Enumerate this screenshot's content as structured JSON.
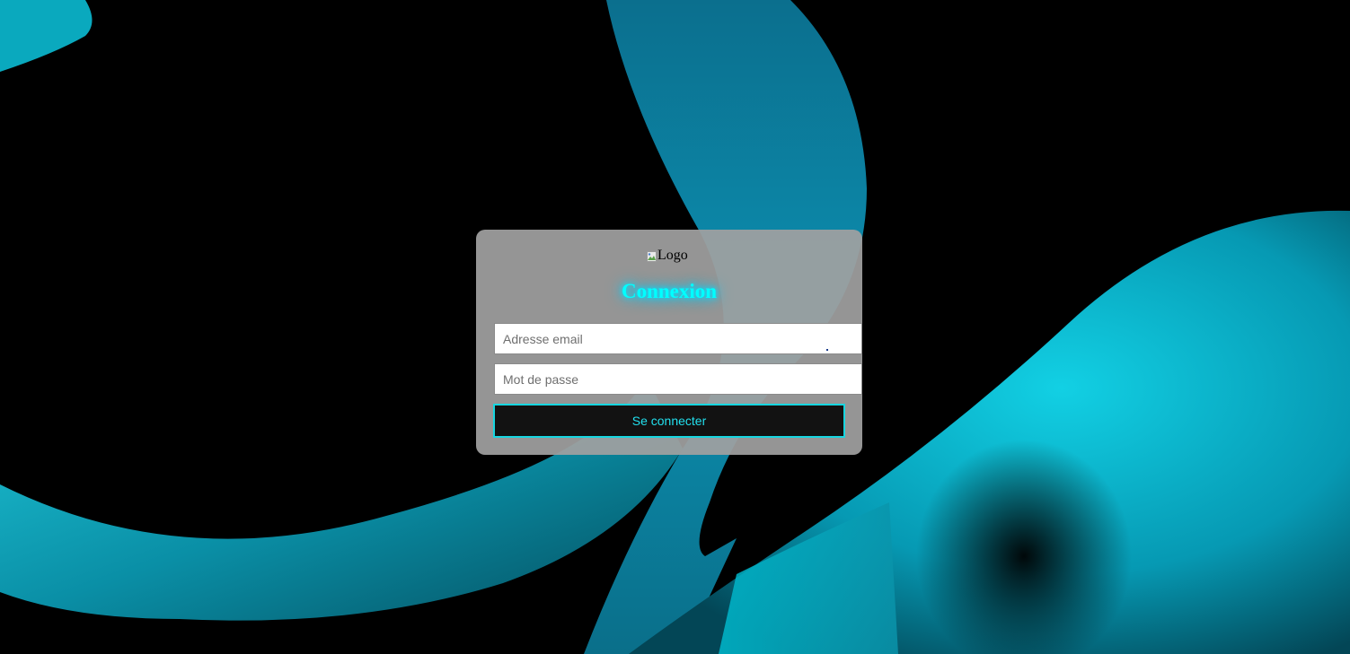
{
  "background": {
    "base_color": "#000000",
    "accent_color": "#00a9c0"
  },
  "login": {
    "logo_alt": "Logo",
    "title": "Connexion",
    "email_placeholder": "Adresse email",
    "password_placeholder": "Mot de passe",
    "submit_label": "Se connecter",
    "title_color": "#00ffff",
    "button_border_color": "#16d6e0"
  }
}
